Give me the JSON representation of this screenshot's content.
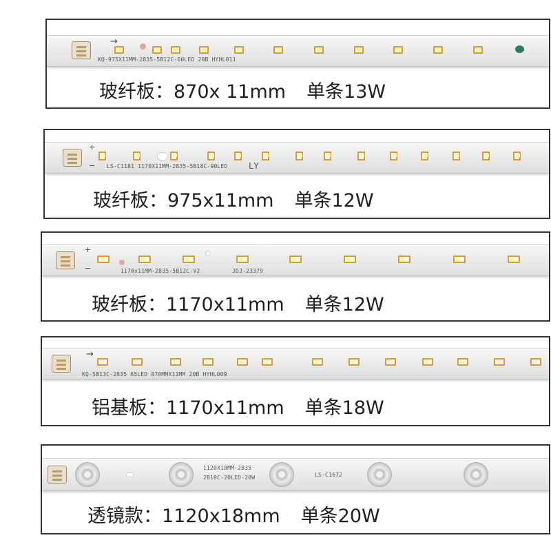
{
  "products": [
    {
      "material": "玻纤板：",
      "size": "870x 11mm",
      "power": "单条13W",
      "silkscreen": "KQ-975X11MM-2835-5B12C-60LED 20B HYHL011"
    },
    {
      "material": "玻纤板：",
      "size": "975x11mm",
      "power": "单条12W",
      "silkscreen": "LS-C1181 1170X11MM-2835-5B18C-90LED",
      "mark": "LY"
    },
    {
      "material": "玻纤板：",
      "size": "1170x11mm",
      "power": "单条12W",
      "silkscreen": "1170x11MM-2835-5B12C-V2",
      "mark": "JDJ-23379"
    },
    {
      "material": "铝基板：",
      "size": "1170x11mm",
      "power": "单条18W",
      "silkscreen": "KQ-5B13C-2835 65LED 870MMX11MM 20B HYHL009"
    },
    {
      "material": "透镜款：",
      "size": "1120x18mm",
      "power": "单条20W",
      "silkscreen": "1120X18MM-2835",
      "silkscreen2": "2B10C-20LED-20W",
      "mark": "LS-C1672"
    }
  ],
  "icons": {
    "arrow": "→",
    "plus": "+",
    "minus": "−"
  }
}
